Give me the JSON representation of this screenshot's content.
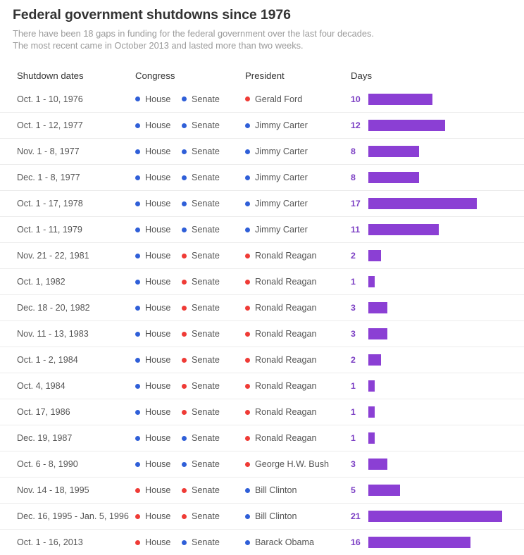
{
  "header": {
    "title": "Federal government shutdowns since 1976",
    "subtitle_line1": "There have been 18 gaps in funding for the federal government over the last four decades.",
    "subtitle_line2": "The most recent came in October 2013 and lasted more than two weeks."
  },
  "columns": {
    "dates": "Shutdown dates",
    "congress": "Congress",
    "president": "President",
    "days": "Days"
  },
  "labels": {
    "house": "House",
    "senate": "Senate"
  },
  "colors": {
    "democrat": "#2f5fd8",
    "republican": "#ef3b36",
    "bar": "#8b3fd4",
    "days_text": "#7c3fc4",
    "title": "#333333",
    "subtitle": "#9a9a9a",
    "row_text": "#555555",
    "row_divider": "#ececec"
  },
  "chart_data": {
    "type": "bar",
    "title": "Federal government shutdowns since 1976",
    "subtitle": "There have been 18 gaps in funding for the federal government over the last four decades. The most recent came in October 2013 and lasted more than two weeks.",
    "xlabel": "Days",
    "ylabel": "",
    "orientation": "horizontal",
    "xlim": [
      0,
      21
    ],
    "grid": false,
    "legend": "none",
    "categories": [
      "Oct. 1 - 10, 1976",
      "Oct. 1 - 12, 1977",
      "Nov. 1 - 8, 1977",
      "Dec. 1 - 8, 1977",
      "Oct. 1 - 17, 1978",
      "Oct. 1 - 11, 1979",
      "Nov. 21 - 22, 1981",
      "Oct. 1, 1982",
      "Dec. 18 - 20, 1982",
      "Nov. 11 - 13, 1983",
      "Oct. 1 - 2, 1984",
      "Oct. 4, 1984",
      "Oct. 17, 1986",
      "Dec. 19, 1987",
      "Oct. 6 - 8, 1990",
      "Nov. 14 - 18, 1995",
      "Dec. 16, 1995 - Jan. 5, 1996",
      "Oct. 1 - 16, 2013"
    ],
    "values": [
      10,
      12,
      8,
      8,
      17,
      11,
      2,
      1,
      3,
      3,
      2,
      1,
      1,
      1,
      3,
      5,
      21,
      16
    ],
    "series": [
      {
        "name": "Days",
        "values": [
          10,
          12,
          8,
          8,
          17,
          11,
          2,
          1,
          3,
          3,
          2,
          1,
          1,
          1,
          3,
          5,
          21,
          16
        ]
      }
    ]
  },
  "rows": [
    {
      "dates": "Oct. 1 - 10, 1976",
      "house": "dem",
      "senate": "dem",
      "president": "Gerald Ford",
      "president_party": "rep",
      "days": 10
    },
    {
      "dates": "Oct. 1 - 12, 1977",
      "house": "dem",
      "senate": "dem",
      "president": "Jimmy Carter",
      "president_party": "dem",
      "days": 12
    },
    {
      "dates": "Nov. 1 - 8, 1977",
      "house": "dem",
      "senate": "dem",
      "president": "Jimmy Carter",
      "president_party": "dem",
      "days": 8
    },
    {
      "dates": "Dec. 1 - 8, 1977",
      "house": "dem",
      "senate": "dem",
      "president": "Jimmy Carter",
      "president_party": "dem",
      "days": 8
    },
    {
      "dates": "Oct. 1 - 17, 1978",
      "house": "dem",
      "senate": "dem",
      "president": "Jimmy Carter",
      "president_party": "dem",
      "days": 17
    },
    {
      "dates": "Oct. 1 - 11, 1979",
      "house": "dem",
      "senate": "dem",
      "president": "Jimmy Carter",
      "president_party": "dem",
      "days": 11
    },
    {
      "dates": "Nov. 21 - 22, 1981",
      "house": "dem",
      "senate": "rep",
      "president": "Ronald Reagan",
      "president_party": "rep",
      "days": 2
    },
    {
      "dates": "Oct. 1, 1982",
      "house": "dem",
      "senate": "rep",
      "president": "Ronald Reagan",
      "president_party": "rep",
      "days": 1
    },
    {
      "dates": "Dec. 18 - 20, 1982",
      "house": "dem",
      "senate": "rep",
      "president": "Ronald Reagan",
      "president_party": "rep",
      "days": 3
    },
    {
      "dates": "Nov. 11 - 13, 1983",
      "house": "dem",
      "senate": "rep",
      "president": "Ronald Reagan",
      "president_party": "rep",
      "days": 3
    },
    {
      "dates": "Oct. 1 - 2, 1984",
      "house": "dem",
      "senate": "rep",
      "president": "Ronald Reagan",
      "president_party": "rep",
      "days": 2
    },
    {
      "dates": "Oct. 4, 1984",
      "house": "dem",
      "senate": "rep",
      "president": "Ronald Reagan",
      "president_party": "rep",
      "days": 1
    },
    {
      "dates": "Oct. 17, 1986",
      "house": "dem",
      "senate": "rep",
      "president": "Ronald Reagan",
      "president_party": "rep",
      "days": 1
    },
    {
      "dates": "Dec. 19, 1987",
      "house": "dem",
      "senate": "dem",
      "president": "Ronald Reagan",
      "president_party": "rep",
      "days": 1
    },
    {
      "dates": "Oct. 6 - 8, 1990",
      "house": "dem",
      "senate": "dem",
      "president": "George H.W. Bush",
      "president_party": "rep",
      "days": 3
    },
    {
      "dates": "Nov. 14 - 18, 1995",
      "house": "rep",
      "senate": "rep",
      "president": "Bill Clinton",
      "president_party": "dem",
      "days": 5
    },
    {
      "dates": "Dec. 16, 1995 - Jan. 5, 1996",
      "house": "rep",
      "senate": "rep",
      "president": "Bill Clinton",
      "president_party": "dem",
      "days": 21
    },
    {
      "dates": "Oct. 1 - 16, 2013",
      "house": "rep",
      "senate": "dem",
      "president": "Barack Obama",
      "president_party": "dem",
      "days": 16
    }
  ]
}
